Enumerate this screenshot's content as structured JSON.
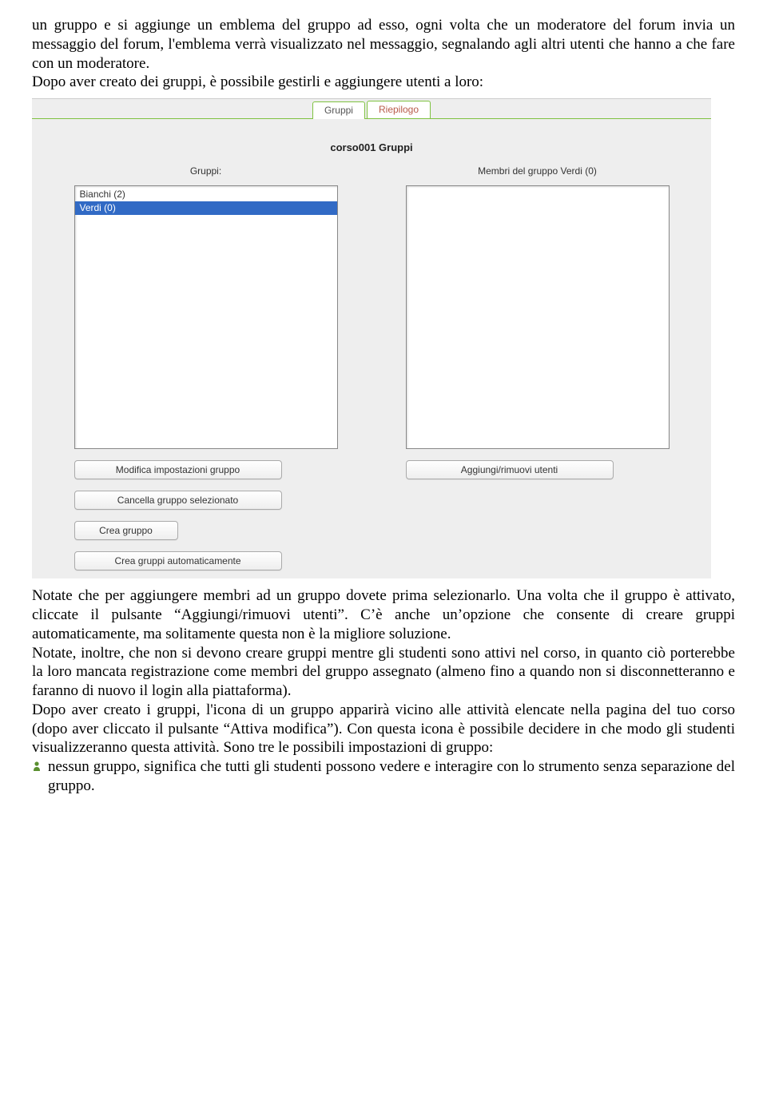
{
  "doc": {
    "para1": "un gruppo e si aggiunge un emblema del gruppo ad esso, ogni volta che un moderatore del forum invia un messaggio del forum, l'emblema verrà visualizzato nel messaggio, segnalando agli altri utenti che hanno a che fare con un moderatore.",
    "para2": "Dopo aver creato dei gruppi, è possibile gestirli e aggiungere utenti a loro:",
    "para3": "Notate che per aggiungere membri ad un gruppo dovete prima selezionarlo. Una volta che il gruppo è attivato, cliccate il pulsante “Aggiungi/rimuovi utenti”. C’è anche un’opzione che consente di creare gruppi automaticamente, ma solitamente questa non è la migliore soluzione.",
    "para4": "Notate, inoltre, che non si devono creare gruppi mentre gli studenti sono attivi nel corso, in quanto ciò porterebbe la loro  mancata registrazione come membri del gruppo assegnato (almeno fino a quando non si disconnetteranno e faranno di nuovo il login alla piattaforma).",
    "para5": "Dopo aver creato i gruppi, l'icona di un gruppo apparirà vicino alle attività elencate nella pagina del tuo corso (dopo aver cliccato il pulsante “Attiva modifica”). Con questa icona è possibile decidere in che modo gli studenti visualizzeranno questa attività. Sono tre le possibili impostazioni di gruppo:",
    "bullet1": "nessun gruppo, significa che tutti gli studenti possono vedere e interagire con lo strumento senza separazione del gruppo."
  },
  "ui": {
    "tabs": {
      "active": "Gruppi",
      "other": "Riepilogo"
    },
    "title": "corso001 Gruppi",
    "left": {
      "label": "Gruppi:",
      "items": [
        "Bianchi (2)",
        "Verdi (0)"
      ],
      "selected_index": 1,
      "buttons": {
        "edit": "Modifica impostazioni gruppo",
        "delete": "Cancella gruppo selezionato",
        "create": "Crea gruppo",
        "auto": "Crea gruppi automaticamente"
      }
    },
    "right": {
      "label": "Membri del gruppo Verdi (0)",
      "buttons": {
        "addremove": "Aggiungi/rimuovi utenti"
      }
    }
  }
}
